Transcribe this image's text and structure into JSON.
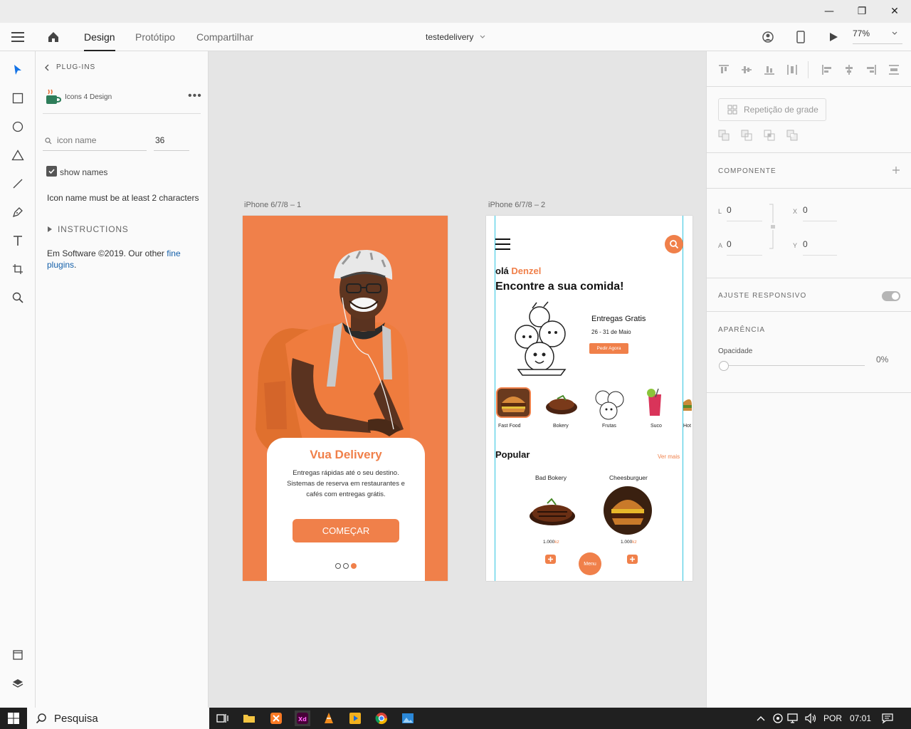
{
  "window": {
    "minimize_glyph": "—",
    "restore_glyph": "❐",
    "close_glyph": "✕"
  },
  "menubar": {
    "tabs": [
      {
        "label": "Design"
      },
      {
        "label": "Protótipo"
      },
      {
        "label": "Compartilhar"
      }
    ],
    "doc_title": "testedelivery",
    "zoom": "77%"
  },
  "tools": [
    "select-icon",
    "rectangle-icon",
    "ellipse-icon",
    "triangle-icon",
    "line-icon",
    "pen-icon",
    "text-icon",
    "artboard-icon",
    "zoom-icon"
  ],
  "plugins": {
    "header": "PLUG-INS",
    "plugin_name": "Icons 4 Design",
    "search_placeholder": "icon name",
    "size_value": "36",
    "show_names_label": "show names",
    "show_names_checked": true,
    "message": "Icon name must be at least 2 characters",
    "instructions_label": "INSTRUCTIONS",
    "footer_text": "Em Software ©2019. Our other",
    "footer_link": "fine plugins",
    "footer_end": "."
  },
  "artboards": {
    "a1": {
      "label": "iPhone 6/7/8 – 1",
      "title": "Vua Delivery",
      "desc_line1": "Entregas rápidas até o seu destino.",
      "desc_line2": "Sistemas de reserva em restaurantes e",
      "desc_line3": "cafés com entregas grátis.",
      "cta": "COMEÇAR",
      "accent": "#f0804a"
    },
    "a2": {
      "label": "iPhone 6/7/8 – 2",
      "greeting": "olá",
      "user": "Denzel",
      "headline": "Encontre a sua comida!",
      "promo_title": "Entregas Gratis",
      "promo_date": "26 - 31 de Maio",
      "promo_btn": "Pedir Agora",
      "categories": [
        "Fast Food",
        "Bokery",
        "Frutas",
        "Suco",
        "Hot"
      ],
      "popular": "Popular",
      "see_more": "Ver mais",
      "items": [
        {
          "name": "Bad Bokery",
          "price": "1.000",
          "currency": "kz"
        },
        {
          "name": "Cheesburguer",
          "price": "1.000",
          "currency": "kz"
        }
      ],
      "menu_btn": "Menu"
    }
  },
  "right_panel": {
    "grid_repeat": "Repetição de grade",
    "component": "COMPONENTE",
    "l_label": "L",
    "l_value": "0",
    "x_label": "X",
    "x_value": "0",
    "a_label": "A",
    "a_value": "0",
    "y_label": "Y",
    "y_value": "0",
    "responsive": "AJUSTE RESPONSIVO",
    "appearance": "APARÊNCIA",
    "opacity_label": "Opacidade",
    "opacity_value": "0%"
  },
  "taskbar": {
    "search": "Pesquisa",
    "lang": "POR",
    "time": "07:01"
  }
}
